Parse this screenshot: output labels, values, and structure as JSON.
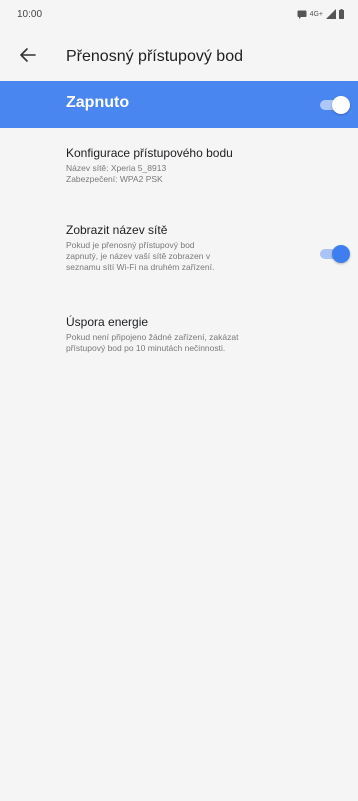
{
  "status_bar": {
    "time": "10:00",
    "network": "4G+",
    "icons": [
      "message-icon",
      "signal-icon",
      "battery-icon"
    ]
  },
  "header": {
    "back_icon": "arrow-left-icon",
    "title": "Přenosný přístupový bod"
  },
  "master_switch": {
    "label": "Zapnuto",
    "on": true
  },
  "settings": {
    "config": {
      "title": "Konfigurace přístupového bodu",
      "line1": "Název sítě: Xperia 5_8913",
      "line2": "Zabezpečení: WPA2 PSK"
    },
    "show_name": {
      "title": "Zobrazit název sítě",
      "line1": "Pokud je přenosný přístupový bod",
      "line2": "zapnutý, je název vaší sítě zobrazen v",
      "line3": "seznamu sítí Wi-Fi na druhém zařízení.",
      "on": true
    },
    "power_saving": {
      "title": "Úspora energie",
      "line1": "Pokud není připojeno žádné zařízení, zakázat",
      "line2": "přístupový bod po 10 minutách nečinnosti."
    }
  },
  "colors": {
    "accent": "#4a86f0",
    "toggle_on": "#3f7ef0",
    "background": "#f5f5f5"
  }
}
